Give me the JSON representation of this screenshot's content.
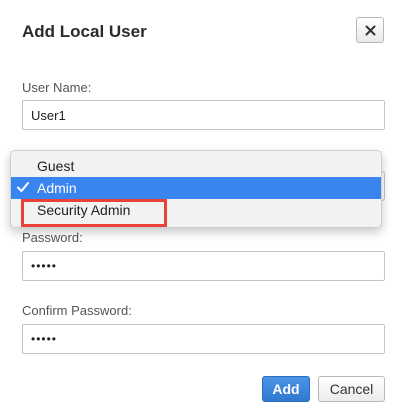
{
  "dialog": {
    "title": "Add Local User",
    "close_icon": "close-icon"
  },
  "form": {
    "username": {
      "label": "User Name:",
      "value": "User1"
    },
    "role": {
      "options": [
        "Guest",
        "Admin",
        "Security Admin"
      ],
      "selected": "Admin",
      "highlighted": "Security Admin",
      "check_icon": "checkmark-icon"
    },
    "password": {
      "label": "Password:",
      "value": "•••••"
    },
    "confirm_password": {
      "label": "Confirm Password:",
      "value": "•••••"
    }
  },
  "buttons": {
    "add_label": "Add",
    "cancel_label": "Cancel"
  },
  "colors": {
    "selection": "#3a84f0",
    "highlight_box": "#e8423a",
    "primary_button": "#3a84f0"
  }
}
